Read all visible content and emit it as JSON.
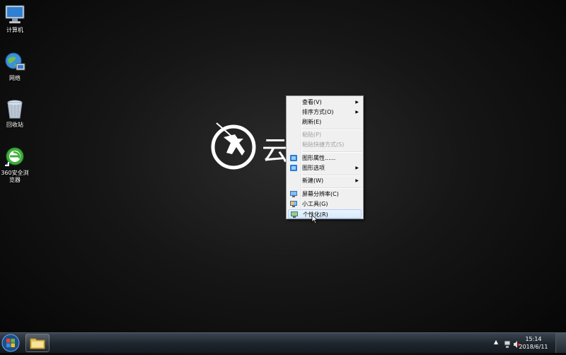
{
  "desktop_icons": [
    {
      "label": "计算机",
      "icon": "computer-icon"
    },
    {
      "label": "网络",
      "icon": "network-icon"
    },
    {
      "label": "回收站",
      "icon": "recycle-bin-icon"
    },
    {
      "label": "360安全浏览器",
      "icon": "360-browser-icon"
    }
  ],
  "wallpaper": {
    "logo_text": "云",
    "accent": "#ffffff"
  },
  "context_menu": {
    "items": [
      {
        "label": "查看(V)",
        "submenu": true,
        "enabled": true
      },
      {
        "label": "排序方式(O)",
        "submenu": true,
        "enabled": true
      },
      {
        "label": "刷新(E)",
        "submenu": false,
        "enabled": true
      },
      {
        "label": "粘贴(P)",
        "submenu": false,
        "enabled": false
      },
      {
        "label": "粘贴快捷方式(S)",
        "submenu": false,
        "enabled": false
      },
      {
        "label": "图形属性......",
        "submenu": false,
        "enabled": true,
        "icon": "graphics-icon"
      },
      {
        "label": "图形选项",
        "submenu": true,
        "enabled": true,
        "icon": "graphics-icon"
      },
      {
        "label": "新建(W)",
        "submenu": true,
        "enabled": true
      },
      {
        "label": "屏幕分辨率(C)",
        "submenu": false,
        "enabled": true,
        "icon": "display-icon"
      },
      {
        "label": "小工具(G)",
        "submenu": false,
        "enabled": true,
        "icon": "gadgets-icon"
      },
      {
        "label": "个性化(R)",
        "submenu": false,
        "enabled": true,
        "icon": "personalize-icon",
        "highlighted": true
      }
    ]
  },
  "taskbar": {
    "start_icon": "windows-start-icon",
    "pinned": [
      {
        "icon": "file-explorer-icon"
      }
    ],
    "tray_icons": [
      "show-hidden-icons-chevron",
      "network-tray-icon",
      "volume-muted-icon"
    ],
    "time": "15:14",
    "date": "2018/6/11"
  }
}
